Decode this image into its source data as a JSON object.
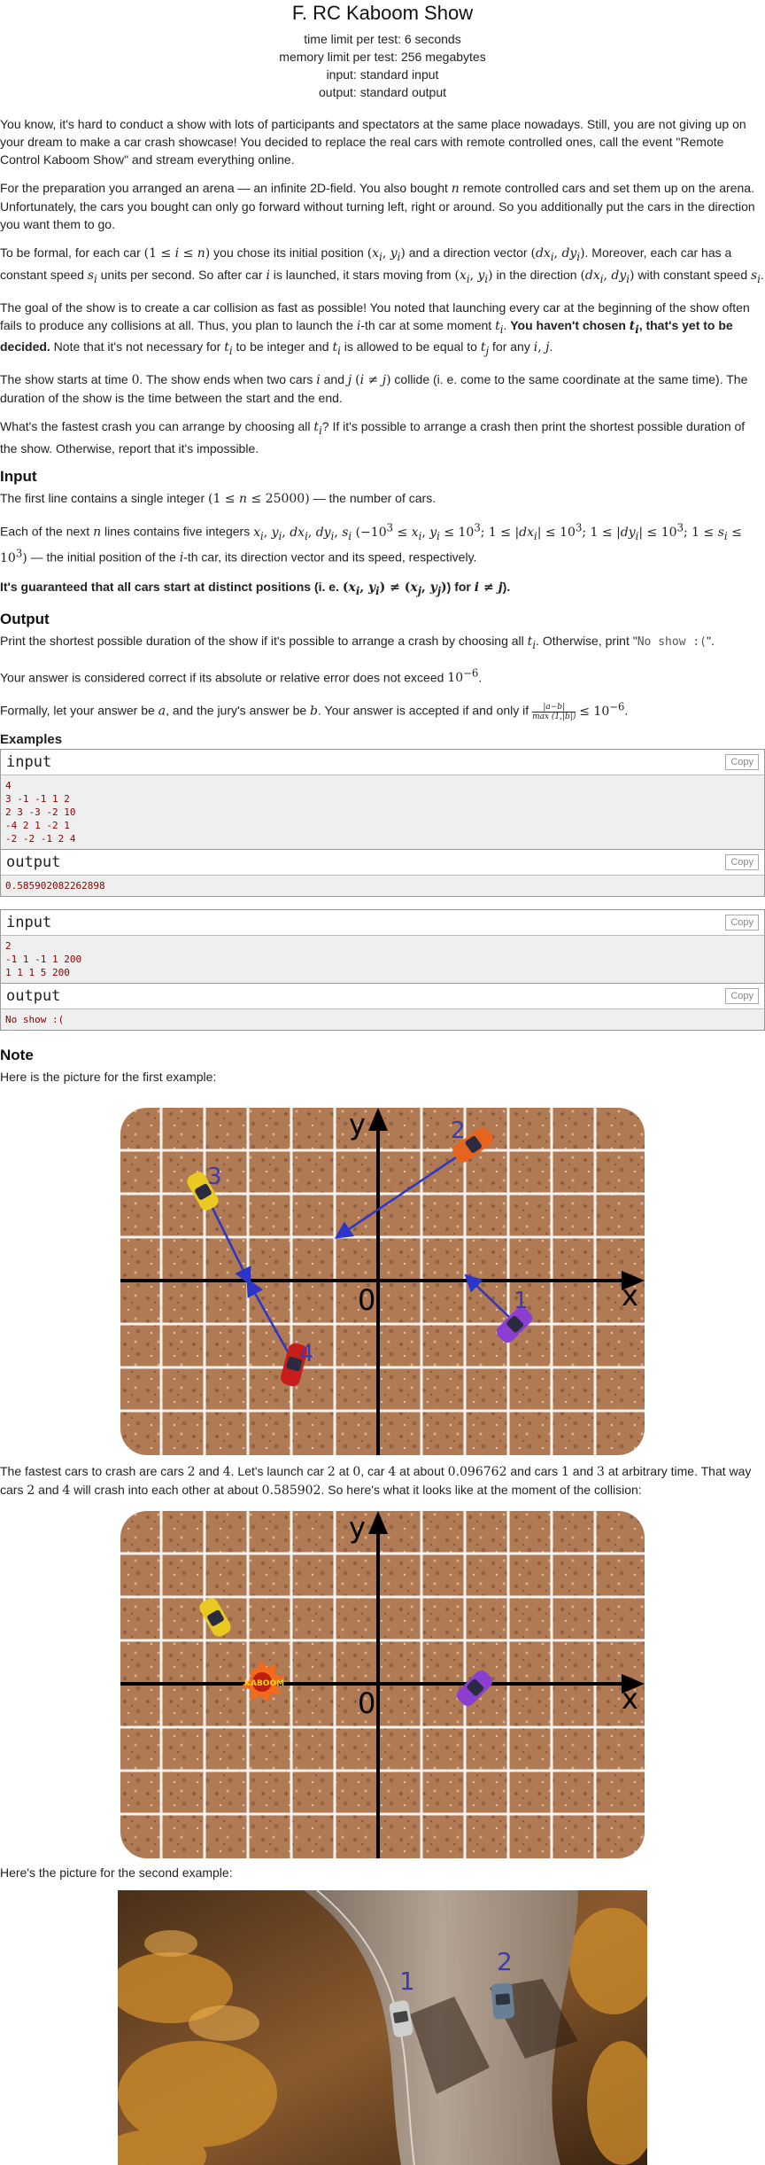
{
  "header": {
    "title": "F. RC Kaboom Show",
    "time_limit": "time limit per test: 6 seconds",
    "memory_limit": "memory limit per test: 256 megabytes",
    "input": "input: standard input",
    "output": "output: standard output"
  },
  "statement": {
    "p1": "You know, it's hard to conduct a show with lots of participants and spectators at the same place nowadays. Still, you are not giving up on your dream to make a car crash showcase! You decided to replace the real cars with remote controlled ones, call the event \"Remote Control Kaboom Show\" and stream everything online.",
    "p2a": "For the preparation you arranged an arena — an infinite 2D-field. You also bought ",
    "p2b": " remote controlled cars and set them up on the arena. Unfortunately, the cars you bought can only go forward without turning left, right or around. So you additionally put the cars in the direction you want them to go.",
    "p3a": "To be formal, for each car ",
    "p3b": " you chose its initial position ",
    "p3c": " and a direction vector ",
    "p3d": ". Moreover, each car has a constant speed ",
    "p3e": " units per second. So after car ",
    "p3f": " is launched, it stars moving from ",
    "p3g": " in the direction ",
    "p3h": " with constant speed ",
    "p4a": "The goal of the show is to create a car collision as fast as possible! You noted that launching every car at the beginning of the show often fails to produce any collisions at all. Thus, you plan to launch the ",
    "p4b": "-th car at some moment ",
    "p4c": "You haven't chosen ",
    "p4d": ", that's yet to be decided.",
    "p4e": " Note that it's not necessary for ",
    "p4f": " to be integer and ",
    "p4g": " is allowed to be equal to ",
    "p4h": " for any ",
    "p5a": "The show starts at time ",
    "p5b": ". The show ends when two cars ",
    "p5c": " and ",
    "p5d": " collide (i. e. come to the same coordinate at the same time). The duration of the show is the time between the start and the end.",
    "p6a": "What's the fastest crash you can arrange by choosing all ",
    "p6b": "? If it's possible to arrange a crash then print the shortest possible duration of the show. Otherwise, report that it's impossible."
  },
  "input_section": {
    "heading": "Input",
    "l1a": "The first line contains a single integer ",
    "l1b": " — the number of cars.",
    "l2a": "Each of the next ",
    "l2b": " lines contains five integers ",
    "l2c": " — the initial position of the ",
    "l2d": "-th car, its direction vector and its speed, respectively.",
    "l3a": "It's guaranteed that all cars start at distinct positions (i. e. ",
    "l3b": " for "
  },
  "output_section": {
    "heading": "Output",
    "l1a": "Print the shortest possible duration of the show if it's possible to arrange a crash by choosing all ",
    "l1b": ". Otherwise, print \"",
    "l1code": "No show :(",
    "l1c": "\".",
    "l2": "Your answer is considered correct if its absolute or relative error does not exceed ",
    "l3a": "Formally, let your answer be ",
    "l3b": ", and the jury's answer be ",
    "l3c": ". Your answer is accepted if and only if "
  },
  "examples": {
    "heading": "Examples",
    "input_label": "input",
    "output_label": "output",
    "copy_label": "Copy",
    "ex1_input": "4\n3 -1 -1 1 2\n2 3 -3 -2 10\n-4 2 1 -2 1\n-2 -2 -1 2 4",
    "ex1_output": "0.585902082262898",
    "ex2_input": "2\n-1 1 -1 1 200\n1 1 1 5 200",
    "ex2_output": "No show :("
  },
  "note": {
    "heading": "Note",
    "intro": "Here is the picture for the first example:",
    "mid_a": "The fastest cars to crash are cars ",
    "mid_b": ". Let's launch car ",
    "mid_c": ", car ",
    "mid_d": " at about ",
    "mid_e": " and cars ",
    "mid_f": " at arbitrary time. That way cars ",
    "mid_g": " will crash into each other at about ",
    "mid_h": ". So here's what it looks like at the moment of the collision:",
    "second": "Here's the picture for the second example:"
  },
  "figure": {
    "axis_x": "x",
    "axis_y": "y",
    "origin": "0",
    "car_labels": [
      "1",
      "2",
      "3",
      "4"
    ],
    "kaboom": "KABOOM",
    "colors": {
      "dirt": "#b07a54",
      "grid": "#ffffff",
      "arrow": "#2b35c9",
      "label": "#3b3bb0",
      "car1": "#8a3fd0",
      "car2": "#e8641e",
      "car3": "#e9c922",
      "car4": "#c81d1d"
    }
  },
  "figure2": {
    "labels": [
      "1",
      "2"
    ]
  }
}
